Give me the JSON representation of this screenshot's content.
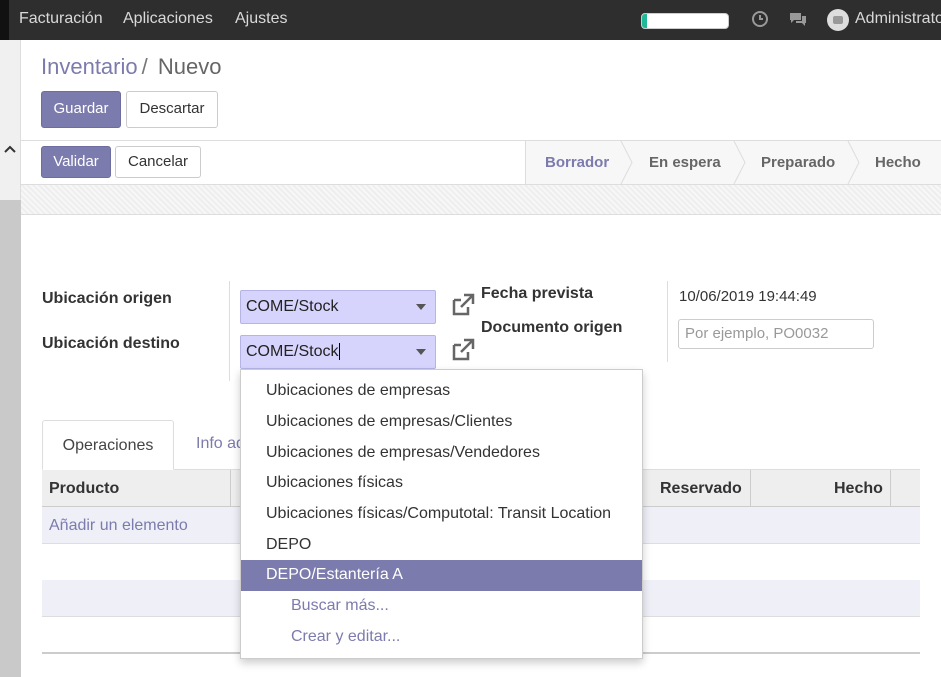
{
  "topbar": {
    "menu": [
      "Facturación",
      "Aplicaciones",
      "Ajustes"
    ],
    "progress_fraction": 0.06,
    "user": "Administrator",
    "icons": [
      "clock-icon",
      "chat-icon",
      "avatar"
    ]
  },
  "breadcrumb": {
    "parent": "Inventario",
    "separator": "/",
    "current": "Nuevo"
  },
  "buttons": {
    "save": "Guardar",
    "discard": "Descartar",
    "validate": "Validar",
    "cancel": "Cancelar"
  },
  "statusbar": {
    "stages": [
      "Borrador",
      "En espera",
      "Preparado",
      "Hecho"
    ],
    "active": "Borrador"
  },
  "form": {
    "source_location_label": "Ubicación origen",
    "source_location_value": "COME/Stock",
    "dest_location_label": "Ubicación destino",
    "dest_location_value": "COME/Stock",
    "scheduled_date_label": "Fecha prevista",
    "scheduled_date_value": "10/06/2019 19:44:49",
    "origin_doc_label": "Documento origen",
    "origin_doc_placeholder": "Por ejemplo, PO0032"
  },
  "tabs": [
    "Operaciones",
    "Info adicional"
  ],
  "table": {
    "headers": {
      "product": "Producto",
      "reserved": "Reservado",
      "done": "Hecho"
    },
    "add_line": "Añadir un elemento"
  },
  "dropdown": {
    "items": [
      "Ubicaciones de empresas",
      "Ubicaciones de empresas/Clientes",
      "Ubicaciones de empresas/Vendedores",
      "Ubicaciones físicas",
      "Ubicaciones físicas/Computotal: Transit Location",
      "DEPO",
      "DEPO/Estantería A"
    ],
    "selected": "DEPO/Estantería A",
    "search_more": "Buscar más...",
    "create_edit": "Crear y editar..."
  },
  "colors": {
    "brand": "#7c7bad",
    "field_bg": "#d6d4fc",
    "progress": "#21b799",
    "topbar": "#2e2e2e"
  }
}
